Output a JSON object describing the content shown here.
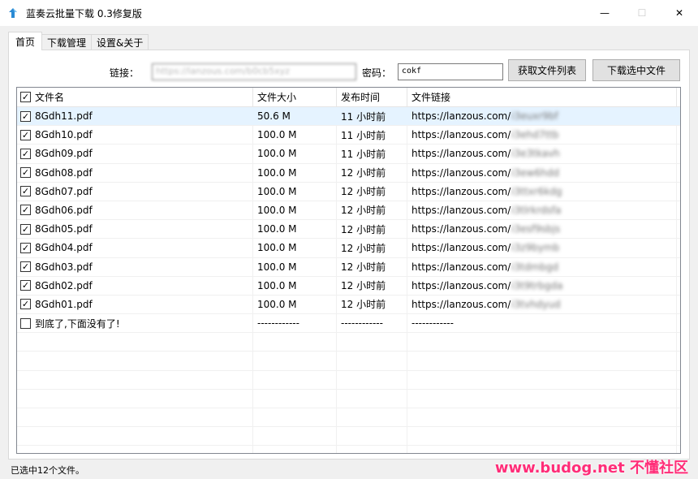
{
  "window": {
    "title": "蓝奏云批量下载 0.3修复版",
    "minimize": "—",
    "maximize": "☐",
    "close": "✕"
  },
  "tabs": [
    {
      "label": "首页",
      "active": true
    },
    {
      "label": "下载管理",
      "active": false
    },
    {
      "label": "设置&关于",
      "active": false
    }
  ],
  "form": {
    "link_label": "链接：",
    "link_value": "https://lanzous.com/b0cb5xyz",
    "password_label": "密码：",
    "password_value": "cokf",
    "fetch_button": "获取文件列表",
    "download_button": "下载选中文件"
  },
  "table": {
    "headers": [
      "文件名",
      "文件大小",
      "发布时间",
      "文件链接"
    ],
    "rows": [
      {
        "checked": true,
        "name": "8Gdh11.pdf",
        "size": "50.6 M",
        "time": "11 小时前",
        "link": "https://lanzous.com/",
        "link_hidden": "i3euxr9bf",
        "selected": true
      },
      {
        "checked": true,
        "name": "8Gdh10.pdf",
        "size": "100.0 M",
        "time": "11 小时前",
        "link": "https://lanzous.com/",
        "link_hidden": "i3ehd7ttb",
        "selected": false
      },
      {
        "checked": true,
        "name": "8Gdh09.pdf",
        "size": "100.0 M",
        "time": "11 小时前",
        "link": "https://lanzous.com/",
        "link_hidden": "i3e3tkavh",
        "selected": false
      },
      {
        "checked": true,
        "name": "8Gdh08.pdf",
        "size": "100.0 M",
        "time": "12 小时前",
        "link": "https://lanzous.com/",
        "link_hidden": "i3ew6hdd",
        "selected": false
      },
      {
        "checked": true,
        "name": "8Gdh07.pdf",
        "size": "100.0 M",
        "time": "12 小时前",
        "link": "https://lanzous.com/",
        "link_hidden": "i3ttxr6kdg",
        "selected": false
      },
      {
        "checked": true,
        "name": "8Gdh06.pdf",
        "size": "100.0 M",
        "time": "12 小时前",
        "link": "https://lanzous.com/",
        "link_hidden": "i3tlrkrdsfa",
        "selected": false
      },
      {
        "checked": true,
        "name": "8Gdh05.pdf",
        "size": "100.0 M",
        "time": "12 小时前",
        "link": "https://lanzous.com/",
        "link_hidden": "i3esf9sbjs",
        "selected": false
      },
      {
        "checked": true,
        "name": "8Gdh04.pdf",
        "size": "100.0 M",
        "time": "12 小时前",
        "link": "https://lanzous.com/",
        "link_hidden": "i3z9bymb",
        "selected": false
      },
      {
        "checked": true,
        "name": "8Gdh03.pdf",
        "size": "100.0 M",
        "time": "12 小时前",
        "link": "https://lanzous.com/",
        "link_hidden": "i3tdmbgd",
        "selected": false
      },
      {
        "checked": true,
        "name": "8Gdh02.pdf",
        "size": "100.0 M",
        "time": "12 小时前",
        "link": "https://lanzous.com/",
        "link_hidden": "i3t9trbgda",
        "selected": false
      },
      {
        "checked": true,
        "name": "8Gdh01.pdf",
        "size": "100.0 M",
        "time": "12 小时前",
        "link": "https://lanzous.com/",
        "link_hidden": "i3tvhdyud",
        "selected": false
      },
      {
        "checked": false,
        "name": "到底了,下面没有了!",
        "size": "------------",
        "time": "------------",
        "link": "------------",
        "link_hidden": "",
        "selected": false
      }
    ]
  },
  "status": "已选中12个文件。",
  "watermark": "www.budog.net 不懂社区",
  "colors": {
    "accent_selected_row": "#e5f3ff",
    "watermark": "#ff2d78",
    "app_icon": "#2a8ad4"
  }
}
